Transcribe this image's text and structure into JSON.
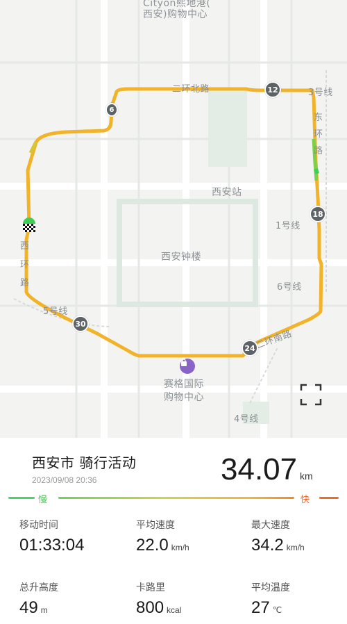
{
  "map": {
    "labels": {
      "top_mall": "Cityon熙地港(",
      "top_mall_2": "西安)购物中心",
      "north_road": "二环北路",
      "east_road_1": "东",
      "east_road_2": "环",
      "east_road_3": "路",
      "station": "西安站",
      "line1": "1号线",
      "bell_tower": "西安钟楼",
      "line6": "6号线",
      "west_road_1": "西",
      "west_road_2": "环",
      "west_road_3": "路",
      "line5": "5号线",
      "south_road": "二环南路",
      "mall_south_1": "赛格国际",
      "mall_south_2": "购物中心",
      "line4": "4号线",
      "line3": "3号线"
    },
    "km_markers": [
      "6",
      "12",
      "18",
      "24",
      "30"
    ]
  },
  "activity": {
    "title": "西安市 骑行活动",
    "datetime": "2023/09/08 20:36",
    "distance": "34.07",
    "distance_unit": "km"
  },
  "legend": {
    "slow": "慢",
    "fast": "快"
  },
  "stats": [
    {
      "label": "移动时间",
      "value": "01:33:04",
      "unit": ""
    },
    {
      "label": "平均速度",
      "value": "22.0",
      "unit": "km/h"
    },
    {
      "label": "最大速度",
      "value": "34.2",
      "unit": "km/h"
    },
    {
      "label": "总升高度",
      "value": "49",
      "unit": "m"
    },
    {
      "label": "卡路里",
      "value": "800",
      "unit": "kcal"
    },
    {
      "label": "平均温度",
      "value": "27",
      "unit": "℃"
    }
  ],
  "colors": {
    "route": "#f0b32a",
    "route_fast": "#7ed04a",
    "marker": "#5d6266",
    "start": "#3fcf55"
  }
}
